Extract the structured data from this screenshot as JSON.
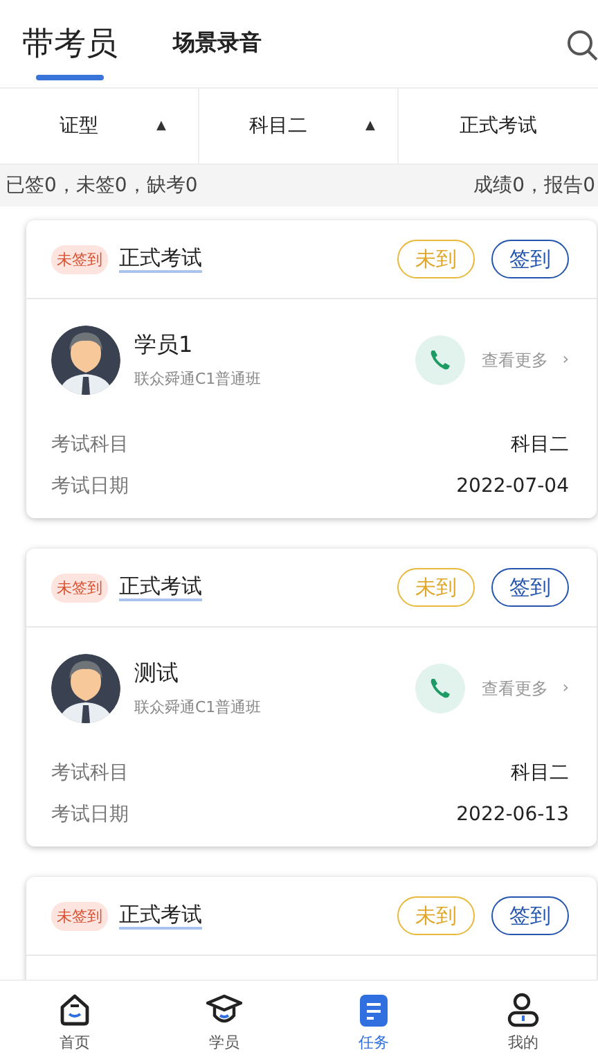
{
  "header": {
    "tabs": [
      {
        "label": "带考员",
        "selected": true
      },
      {
        "label": "场景录音",
        "selected": false
      }
    ]
  },
  "filters": [
    {
      "label": "证型",
      "arrow": "▲"
    },
    {
      "label": "科目二",
      "arrow": "▲"
    },
    {
      "label": "正式考试"
    }
  ],
  "summary": {
    "left": "已签0，未签0，缺考0",
    "right": "成绩0，报告0"
  },
  "cards": [
    {
      "status": "未签到",
      "title": "正式考试",
      "absent_button": "未到",
      "signin_button": "签到",
      "student": {
        "name": "学员1",
        "class": "联众舜通C1普通班",
        "more": "查看更多",
        "chevron": "›"
      },
      "fields": [
        {
          "label": "考试科目",
          "value": "科目二"
        },
        {
          "label": "考试日期",
          "value": "2022-07-04"
        }
      ]
    },
    {
      "status": "未签到",
      "title": "正式考试",
      "absent_button": "未到",
      "signin_button": "签到",
      "student": {
        "name": "测试",
        "class": "联众舜通C1普通班",
        "more": "查看更多",
        "chevron": "›"
      },
      "fields": [
        {
          "label": "考试科目",
          "value": "科目二"
        },
        {
          "label": "考试日期",
          "value": "2022-06-13"
        }
      ]
    },
    {
      "status": "未签到",
      "title": "正式考试",
      "absent_button": "未到",
      "signin_button": "签到"
    }
  ],
  "nav": [
    {
      "label": "首页",
      "kind": "home",
      "selected": false
    },
    {
      "label": "学员",
      "kind": "student",
      "selected": false
    },
    {
      "label": "任务",
      "kind": "task",
      "selected": true
    },
    {
      "label": "我的",
      "kind": "me",
      "selected": false
    }
  ]
}
